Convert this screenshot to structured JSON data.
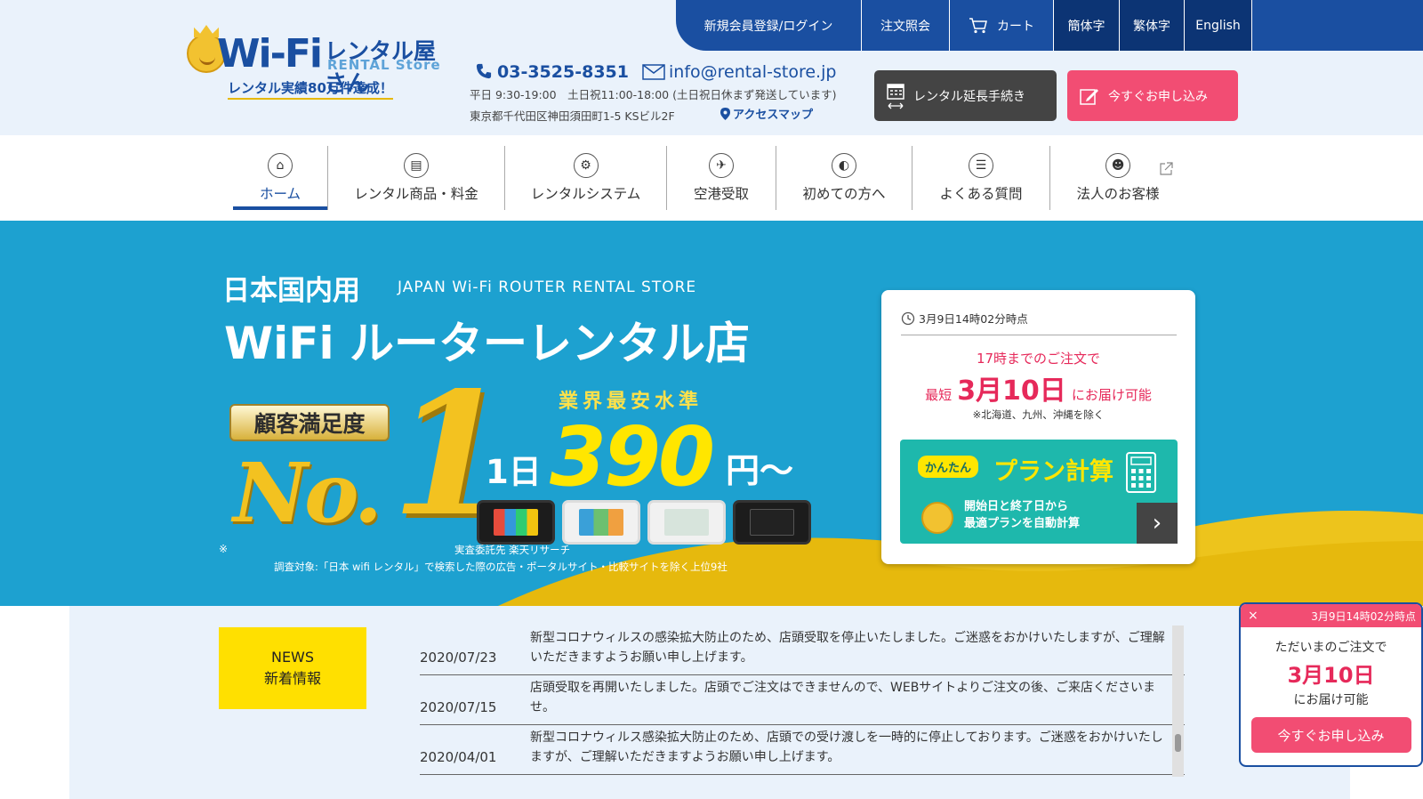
{
  "colors": {
    "brand_blue": "#1a4fa1",
    "hero_blue": "#1da1d0",
    "accent_pink": "#f24d73",
    "gold": "#f3c220",
    "news_yellow": "#ffe000"
  },
  "header": {
    "logo": {
      "wifi": "Wi-Fi",
      "rental_jp": "レンタル屋さん",
      "rental_en": "RENTAL Store",
      "record": "レンタル実績80万件達成！"
    },
    "phone": "03-3525-8351",
    "email": "info@rental-store.jp",
    "hours": "平日 9:30-19:00　土日祝11:00-18:00 (土日祝日休まず発送しています)",
    "address": "東京都千代田区神田須田町1-5 KSビル2F",
    "access_map": "アクセスマップ",
    "extend_button": "レンタル延長手続き",
    "apply_button": "今すぐお申し込み",
    "icons": {
      "phone": "phone-icon",
      "mail": "mail-icon",
      "pin": "map-pin-icon",
      "calendar": "calendar-icon",
      "edit": "edit-icon"
    }
  },
  "topnav": {
    "register": "新規会員登録/ログイン",
    "order_inquiry": "注文照会",
    "cart": "カート",
    "lang_simplified": "簡体字",
    "lang_traditional": "繁体字",
    "lang_english": "English"
  },
  "mainnav": {
    "items": [
      {
        "label": "ホーム",
        "icon": "home-icon"
      },
      {
        "label": "レンタル商品・料金",
        "icon": "product-icon"
      },
      {
        "label": "レンタルシステム",
        "icon": "gear-icon"
      },
      {
        "label": "空港受取",
        "icon": "airplane-icon"
      },
      {
        "label": "初めての方へ",
        "icon": "beginner-icon"
      },
      {
        "label": "よくある質問",
        "icon": "chat-icon"
      },
      {
        "label": "法人のお客様",
        "icon": "business-icon"
      }
    ],
    "active": "ホーム"
  },
  "hero": {
    "title_jp": "日本国内用",
    "title_en": "JAPAN Wi-Fi ROUTER RENTAL STORE",
    "title_main": "WiFi ルーターレンタル店",
    "satisfaction": "顧客満足度",
    "no": "No.",
    "one": "1",
    "lowest": "業界最安水準",
    "per_day": "1日",
    "price": "390",
    "yen": "円〜",
    "note_mark": "※",
    "survey_by": "実査委託先 楽天リサーチ",
    "survey_target": "調査対象:「日本 wifi レンタル」で検索した際の広告・ポータルサイト・比較サイトを除く上位9社"
  },
  "delivery": {
    "timestamp": "3月9日14時02分時点",
    "until": "17時までのご注文で",
    "fastest": "最短",
    "date": "3月10日",
    "deliverable": "にお届け可能",
    "exclusion": "※北海道、九州、沖縄を除く",
    "plan": {
      "kantan": "かんたん",
      "title": "プラン計算",
      "desc_line1": "開始日と終了日から",
      "desc_line2": "最適プランを自動計算",
      "arrow": "›"
    }
  },
  "news": {
    "label_en": "NEWS",
    "label_jp": "新着情報",
    "items": [
      {
        "date": "2020/07/23",
        "text": "新型コロナウィルスの感染拡大防止のため、店頭受取を停止いたしました。ご迷惑をおかけいたしますが、ご理解いただきますようお願い申し上げます。"
      },
      {
        "date": "2020/07/15",
        "text": "店頭受取を再開いたしました。店頭でご注文はできませんので、WEBサイトよりご注文の後、ご来店くださいませ。"
      },
      {
        "date": "2020/04/01",
        "text": "新型コロナウィルス感染拡大防止のため、店頭での受け渡しを一時的に停止しております。ご迷惑をおかけいたしますが、ご理解いただきますようお願い申し上げます。"
      }
    ]
  },
  "popup": {
    "close": "×",
    "timestamp": "3月9日14時02分時点",
    "line1": "ただいまのご注文で",
    "date": "3月10日",
    "line3": "にお届け可能",
    "button": "今すぐお申し込み"
  }
}
